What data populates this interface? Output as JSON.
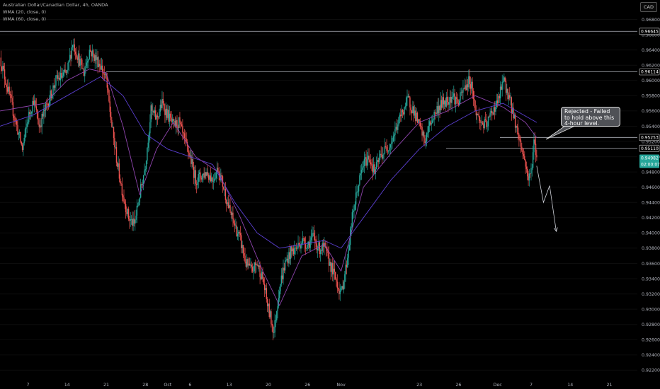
{
  "header": {
    "title": "Australian Dollar/Canadian Dollar, 4h, OANDA",
    "indicators": [
      "WMA (20, close, 0)",
      "WMA (60, close, 0)"
    ],
    "currency": "CAD"
  },
  "annotation": {
    "text": "Rejected - Failed to hold above this 4-hour level."
  },
  "colors": {
    "background": "#000000",
    "up": "#26a69a",
    "down": "#ef5350",
    "wma20": "#8e44ad",
    "wma60": "#5b3fd1",
    "price_badge": "#26a69a",
    "level_line": "#b2b5be",
    "projection": "#d1d4dc"
  },
  "chart_data": {
    "type": "candlestick",
    "title": "Australian Dollar/Canadian Dollar, 4h, OANDA",
    "ylim": [
      0.9212,
      0.97
    ],
    "y_ticks": [
      0.968,
      0.966,
      0.964,
      0.962,
      0.96,
      0.958,
      0.956,
      0.954,
      0.952,
      0.95,
      0.948,
      0.946,
      0.944,
      0.942,
      0.94,
      0.938,
      0.936,
      0.934,
      0.932,
      0.93,
      0.928,
      0.926,
      0.924,
      0.922
    ],
    "y_tick_labels": [
      "0.96800",
      "0.96600",
      "0.96400",
      "0.96200",
      "0.96000",
      "0.95800",
      "0.95600",
      "0.95400",
      "0.95200",
      "0.95000",
      "0.94800",
      "0.94600",
      "0.94400",
      "0.94200",
      "0.94000",
      "0.93800",
      "0.93600",
      "0.93400",
      "0.93200",
      "0.93000",
      "0.92800",
      "0.92600",
      "0.92400",
      "0.92200"
    ],
    "x_ticks": [
      {
        "day": 7,
        "label": "7"
      },
      {
        "day": 14,
        "label": "14"
      },
      {
        "day": 21,
        "label": "21"
      },
      {
        "day": 28,
        "label": "28"
      },
      {
        "day": 32,
        "label": "Oct"
      },
      {
        "day": 36,
        "label": "6"
      },
      {
        "day": 43,
        "label": "13"
      },
      {
        "day": 50,
        "label": "20"
      },
      {
        "day": 57,
        "label": "26"
      },
      {
        "day": 63,
        "label": "Nov"
      },
      {
        "day": 77,
        "label": "23"
      },
      {
        "day": 84,
        "label": "26"
      },
      {
        "day": 91,
        "label": "Dec"
      },
      {
        "day": 97,
        "label": "7"
      },
      {
        "day": 104,
        "label": "14"
      },
      {
        "day": 111,
        "label": "21"
      }
    ],
    "x_range_days": [
      2,
      116
    ],
    "key_levels": [
      {
        "value": 0.96645,
        "label": "0.96645"
      },
      {
        "value": 0.96114,
        "label": "0.96114"
      },
      {
        "value": 0.95253,
        "label": "0.95253"
      },
      {
        "value": 0.9511,
        "label": "0.95110"
      }
    ],
    "current_price": {
      "value": 0.94982,
      "label": "0.94982",
      "countdown": "02:00:07"
    },
    "price_path": [
      {
        "day": 2,
        "value": 0.963
      },
      {
        "day": 3,
        "value": 0.96
      },
      {
        "day": 5,
        "value": 0.954
      },
      {
        "day": 6,
        "value": 0.951
      },
      {
        "day": 7,
        "value": 0.955
      },
      {
        "day": 8,
        "value": 0.9575
      },
      {
        "day": 9,
        "value": 0.954
      },
      {
        "day": 10,
        "value": 0.956
      },
      {
        "day": 12,
        "value": 0.96
      },
      {
        "day": 14,
        "value": 0.961
      },
      {
        "day": 15,
        "value": 0.965
      },
      {
        "day": 16,
        "value": 0.963
      },
      {
        "day": 17,
        "value": 0.961
      },
      {
        "day": 18,
        "value": 0.964
      },
      {
        "day": 19,
        "value": 0.963
      },
      {
        "day": 20,
        "value": 0.962
      },
      {
        "day": 21,
        "value": 0.96
      },
      {
        "day": 22,
        "value": 0.954
      },
      {
        "day": 23,
        "value": 0.949
      },
      {
        "day": 24,
        "value": 0.945
      },
      {
        "day": 25,
        "value": 0.942
      },
      {
        "day": 26,
        "value": 0.941
      },
      {
        "day": 27,
        "value": 0.945
      },
      {
        "day": 28,
        "value": 0.949
      },
      {
        "day": 29,
        "value": 0.956
      },
      {
        "day": 30,
        "value": 0.955
      },
      {
        "day": 31,
        "value": 0.957
      },
      {
        "day": 32,
        "value": 0.9555
      },
      {
        "day": 33,
        "value": 0.954
      },
      {
        "day": 34,
        "value": 0.9545
      },
      {
        "day": 35,
        "value": 0.952
      },
      {
        "day": 36,
        "value": 0.95
      },
      {
        "day": 37,
        "value": 0.947
      },
      {
        "day": 38,
        "value": 0.9475
      },
      {
        "day": 39,
        "value": 0.948
      },
      {
        "day": 40,
        "value": 0.947
      },
      {
        "day": 41,
        "value": 0.9485
      },
      {
        "day": 42,
        "value": 0.946
      },
      {
        "day": 43,
        "value": 0.943
      },
      {
        "day": 44,
        "value": 0.941
      },
      {
        "day": 45,
        "value": 0.939
      },
      {
        "day": 46,
        "value": 0.936
      },
      {
        "day": 47,
        "value": 0.935
      },
      {
        "day": 48,
        "value": 0.936
      },
      {
        "day": 49,
        "value": 0.934
      },
      {
        "day": 50,
        "value": 0.93
      },
      {
        "day": 51,
        "value": 0.927
      },
      {
        "day": 52,
        "value": 0.933
      },
      {
        "day": 53,
        "value": 0.936
      },
      {
        "day": 54,
        "value": 0.9375
      },
      {
        "day": 55,
        "value": 0.938
      },
      {
        "day": 56,
        "value": 0.939
      },
      {
        "day": 57,
        "value": 0.9385
      },
      {
        "day": 58,
        "value": 0.9395
      },
      {
        "day": 59,
        "value": 0.938
      },
      {
        "day": 60,
        "value": 0.938
      },
      {
        "day": 61,
        "value": 0.936
      },
      {
        "day": 62,
        "value": 0.934
      },
      {
        "day": 63,
        "value": 0.932
      },
      {
        "day": 64,
        "value": 0.936
      },
      {
        "day": 65,
        "value": 0.942
      },
      {
        "day": 66,
        "value": 0.946
      },
      {
        "day": 67,
        "value": 0.949
      },
      {
        "day": 68,
        "value": 0.95
      },
      {
        "day": 69,
        "value": 0.948
      },
      {
        "day": 70,
        "value": 0.95
      },
      {
        "day": 71,
        "value": 0.951
      },
      {
        "day": 72,
        "value": 0.952
      },
      {
        "day": 73,
        "value": 0.954
      },
      {
        "day": 74,
        "value": 0.956
      },
      {
        "day": 75,
        "value": 0.9575
      },
      {
        "day": 76,
        "value": 0.956
      },
      {
        "day": 77,
        "value": 0.954
      },
      {
        "day": 78,
        "value": 0.952
      },
      {
        "day": 79,
        "value": 0.9545
      },
      {
        "day": 80,
        "value": 0.956
      },
      {
        "day": 81,
        "value": 0.957
      },
      {
        "day": 82,
        "value": 0.9575
      },
      {
        "day": 83,
        "value": 0.958
      },
      {
        "day": 84,
        "value": 0.957
      },
      {
        "day": 85,
        "value": 0.959
      },
      {
        "day": 86,
        "value": 0.96
      },
      {
        "day": 86.5,
        "value": 0.959
      },
      {
        "day": 87,
        "value": 0.956
      },
      {
        "day": 88,
        "value": 0.9545
      },
      {
        "day": 89,
        "value": 0.954
      },
      {
        "day": 90,
        "value": 0.956
      },
      {
        "day": 91,
        "value": 0.957
      },
      {
        "day": 92,
        "value": 0.96
      },
      {
        "day": 93,
        "value": 0.958
      },
      {
        "day": 94,
        "value": 0.955
      },
      {
        "day": 95,
        "value": 0.952
      },
      {
        "day": 96,
        "value": 0.949
      },
      {
        "day": 96.5,
        "value": 0.947
      },
      {
        "day": 97,
        "value": 0.948
      },
      {
        "day": 97.5,
        "value": 0.952
      },
      {
        "day": 98,
        "value": 0.95
      }
    ],
    "wma_20_path": [
      {
        "day": 2,
        "value": 0.956
      },
      {
        "day": 6,
        "value": 0.9565
      },
      {
        "day": 10,
        "value": 0.957
      },
      {
        "day": 14,
        "value": 0.96
      },
      {
        "day": 18,
        "value": 0.9615
      },
      {
        "day": 21,
        "value": 0.961
      },
      {
        "day": 24,
        "value": 0.954
      },
      {
        "day": 27,
        "value": 0.945
      },
      {
        "day": 30,
        "value": 0.951
      },
      {
        "day": 33,
        "value": 0.9545
      },
      {
        "day": 37,
        "value": 0.95
      },
      {
        "day": 41,
        "value": 0.948
      },
      {
        "day": 45,
        "value": 0.942
      },
      {
        "day": 49,
        "value": 0.935
      },
      {
        "day": 52,
        "value": 0.9305
      },
      {
        "day": 56,
        "value": 0.937
      },
      {
        "day": 60,
        "value": 0.9385
      },
      {
        "day": 63,
        "value": 0.935
      },
      {
        "day": 67,
        "value": 0.946
      },
      {
        "day": 72,
        "value": 0.9505
      },
      {
        "day": 77,
        "value": 0.9545
      },
      {
        "day": 82,
        "value": 0.956
      },
      {
        "day": 87,
        "value": 0.958
      },
      {
        "day": 92,
        "value": 0.9565
      },
      {
        "day": 96,
        "value": 0.9545
      },
      {
        "day": 98,
        "value": 0.9525
      }
    ],
    "wma_60_path": [
      {
        "day": 2,
        "value": 0.954
      },
      {
        "day": 8,
        "value": 0.9555
      },
      {
        "day": 14,
        "value": 0.958
      },
      {
        "day": 20,
        "value": 0.9605
      },
      {
        "day": 24,
        "value": 0.958
      },
      {
        "day": 28,
        "value": 0.953
      },
      {
        "day": 32,
        "value": 0.951
      },
      {
        "day": 36,
        "value": 0.95
      },
      {
        "day": 40,
        "value": 0.949
      },
      {
        "day": 44,
        "value": 0.944
      },
      {
        "day": 48,
        "value": 0.94
      },
      {
        "day": 52,
        "value": 0.938
      },
      {
        "day": 56,
        "value": 0.9385
      },
      {
        "day": 60,
        "value": 0.939
      },
      {
        "day": 63,
        "value": 0.938
      },
      {
        "day": 67,
        "value": 0.942
      },
      {
        "day": 72,
        "value": 0.947
      },
      {
        "day": 77,
        "value": 0.951
      },
      {
        "day": 82,
        "value": 0.954
      },
      {
        "day": 87,
        "value": 0.956
      },
      {
        "day": 92,
        "value": 0.957
      },
      {
        "day": 98,
        "value": 0.9545
      }
    ],
    "projection_path": [
      {
        "day": 98.0,
        "value": 0.9488
      },
      {
        "day": 99.2,
        "value": 0.944
      },
      {
        "day": 100.3,
        "value": 0.9462
      },
      {
        "day": 101.5,
        "value": 0.9402
      }
    ]
  }
}
